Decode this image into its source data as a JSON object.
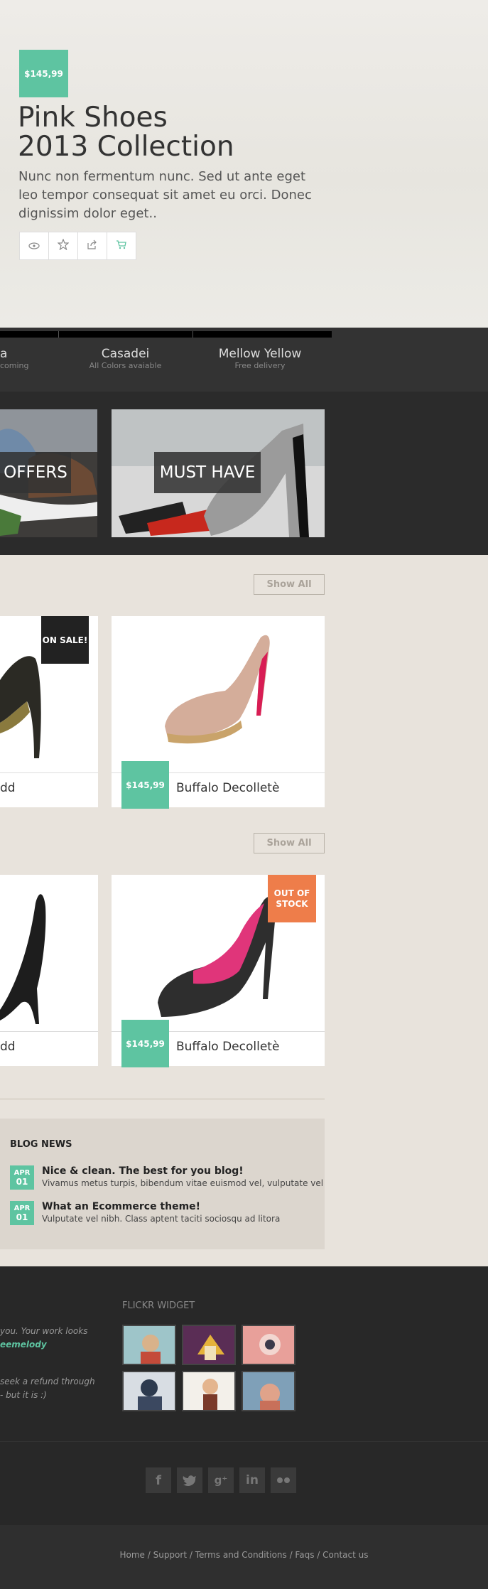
{
  "hero": {
    "price": "$145,99",
    "title_line1": "Pink Shoes",
    "title_line2": "2013 Collection",
    "description": "Nunc non fermentum nunc. Sed ut ante eget leo tempor consequat sit amet eu orci. Donec dignissim dolor eget..",
    "actions": [
      "view-icon",
      "star-icon",
      "share-icon",
      "cart-icon"
    ]
  },
  "slider_tabs": [
    {
      "title": "a",
      "subtitle": "coming"
    },
    {
      "title": "Casadei",
      "subtitle": "All Colors avaiable"
    },
    {
      "title": "Mellow Yellow",
      "subtitle": "Free delivery"
    }
  ],
  "promos": [
    {
      "label": "OFFERS"
    },
    {
      "label": "MUST HAVE"
    }
  ],
  "sections": [
    {
      "show_all": "Show All",
      "products": [
        {
          "name": "dd",
          "badge": "ON SALE!"
        },
        {
          "name": "Buffalo Decolletè",
          "price": "$145,99"
        }
      ]
    },
    {
      "show_all": "Show All",
      "products": [
        {
          "name": "dd"
        },
        {
          "name": "Buffalo Decolletè",
          "price": "$145,99",
          "badge": "OUT OF STOCK"
        }
      ]
    }
  ],
  "blog": {
    "heading": "BLOG NEWS",
    "posts": [
      {
        "month": "APR",
        "day": "01",
        "title": "Nice & clean. The best for you blog!",
        "excerpt": "Vivamus metus turpis, bibendum vitae euismod vel, vulputate vel"
      },
      {
        "month": "APR",
        "day": "01",
        "title": "What an Ecommerce theme!",
        "excerpt": "Vulputate vel nibh. Class aptent taciti sociosqu ad litora"
      }
    ]
  },
  "footer": {
    "testimonials": [
      {
        "line1": "you. Your work looks",
        "author": "eemelody"
      },
      {
        "line1": "seek a refund through",
        "line2": "- but it is :)"
      }
    ],
    "flickr_heading": "FLICKR WIDGET",
    "social": [
      "facebook-icon",
      "twitter-icon",
      "google-plus-icon",
      "linkedin-icon",
      "flickr-icon"
    ],
    "links": "Home / Support / Terms and Conditions / Faqs / Contact us"
  },
  "colors": {
    "accent": "#5ec4a1",
    "oos": "#ee7d4a",
    "dark": "#2b2b2b"
  }
}
